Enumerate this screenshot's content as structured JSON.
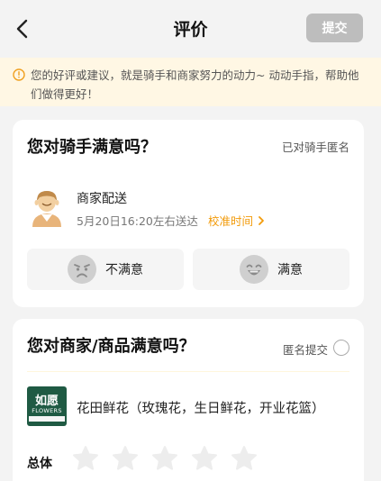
{
  "header": {
    "title": "评价",
    "submit_label": "提交",
    "submit_color": "#bdbdbd"
  },
  "notice": {
    "text": "您的好评或建议，就是骑手和商家努力的动力~ 动动手指，帮助他们做得更好！",
    "icon": "info-icon",
    "color": "#f0a020"
  },
  "rider_card": {
    "title": "您对骑手满意吗？",
    "anonymous_note": "已对骑手匿名",
    "rider_name": "商家配送",
    "delivery_time": "5月20日16:20左右送达",
    "calibrate_label": "校准时间",
    "unsatisfied_label": "不满意",
    "satisfied_label": "满意"
  },
  "merchant_card": {
    "title": "您对商家/商品满意吗？",
    "anonymous_label": "匿名提交",
    "shop_logo_text": "如愿",
    "shop_logo_sub": "FLOWERS",
    "shop_name": "花田鲜花（玫瑰花，生日鲜花，开业花篮）",
    "overall_label": "总体",
    "rating": 0,
    "max_rating": 5
  },
  "accent_color": "#f29b0a"
}
